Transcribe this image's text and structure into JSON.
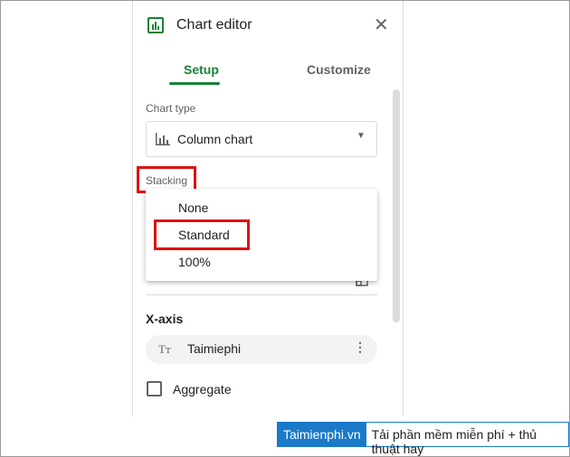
{
  "editor": {
    "title": "Chart editor",
    "close_icon": "close-icon",
    "tabs": [
      {
        "label": "Setup",
        "active": true
      },
      {
        "label": "Customize",
        "active": false
      }
    ],
    "chart_type": {
      "label": "Chart type",
      "value": "Column chart"
    },
    "stacking": {
      "label": "Stacking",
      "options": [
        "None",
        "Standard",
        "100%"
      ],
      "highlighted": "Standard"
    },
    "x_axis": {
      "label": "X-axis",
      "value": "Taimiephi"
    },
    "aggregate": {
      "label": "Aggregate",
      "checked": false
    },
    "accent": "#188038"
  },
  "footer": {
    "brand": "Taimienphi.vn",
    "tagline": "Tải phần mềm miễn phí + thủ thuật hay",
    "brand_color": "#1a7ac8"
  }
}
